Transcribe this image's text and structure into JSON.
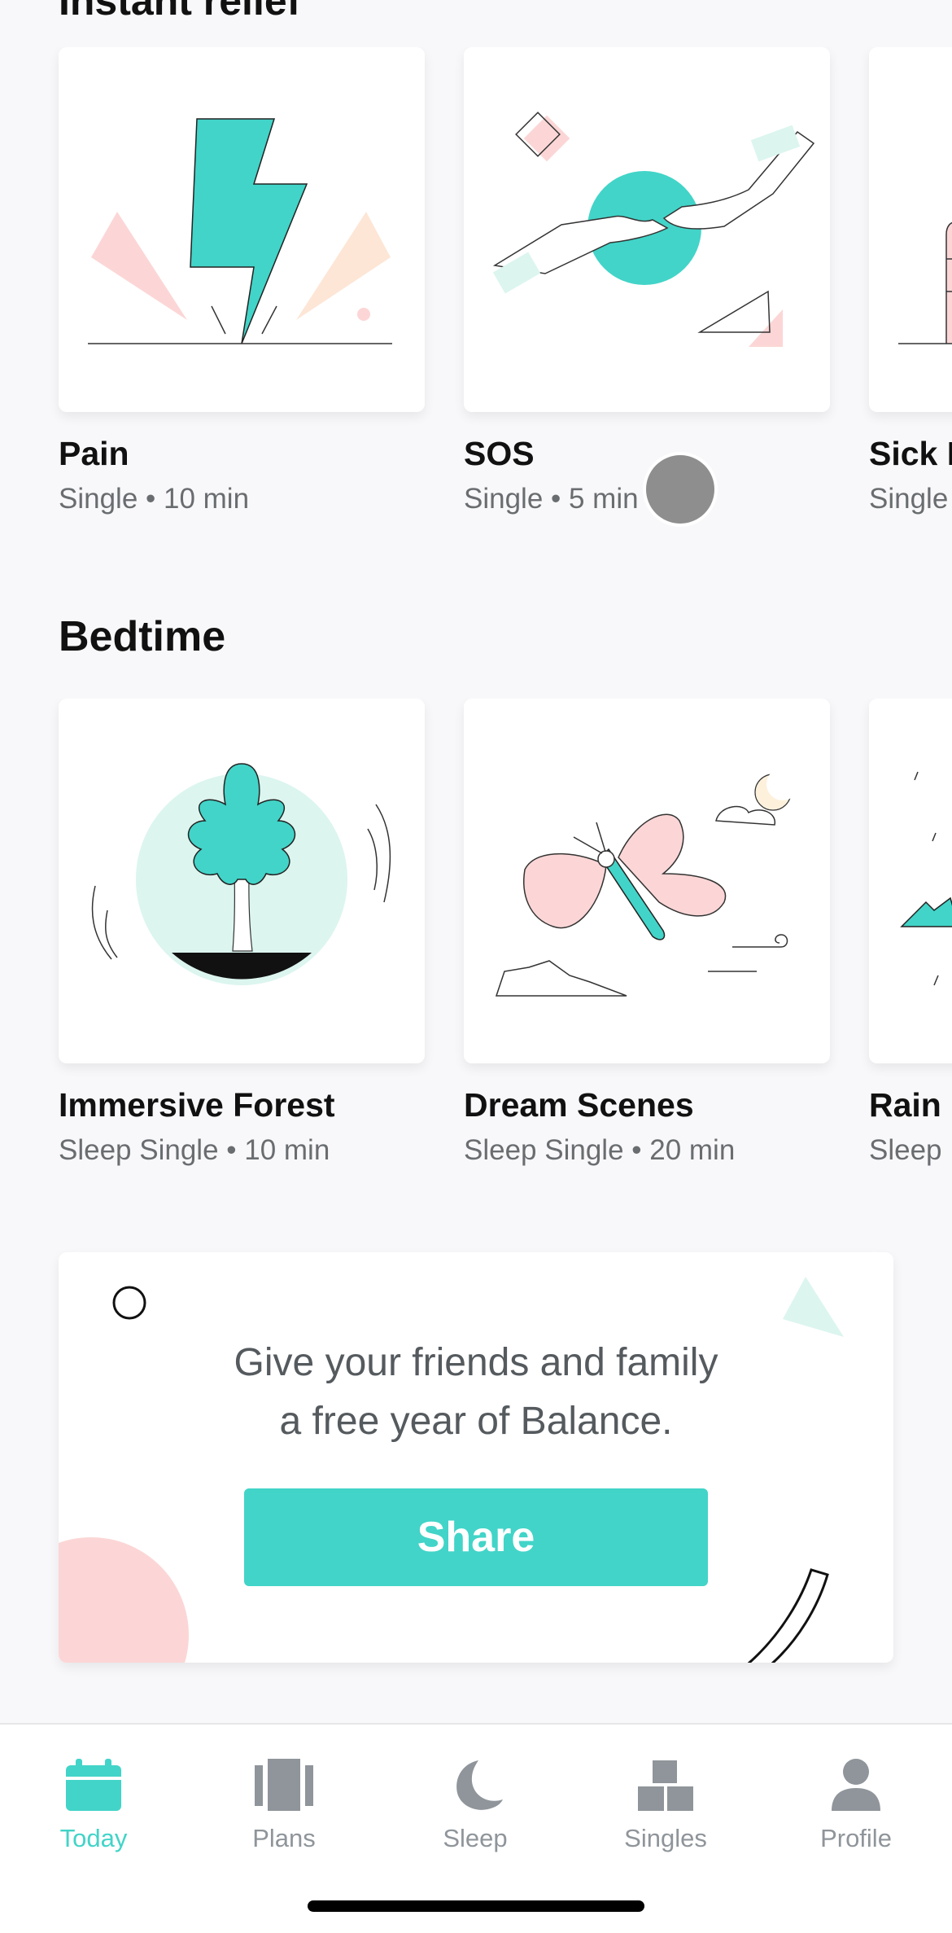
{
  "sections": {
    "instant_relief": {
      "title": "Instant relief",
      "cards": [
        {
          "name": "Pain",
          "meta": "Single • 10 min",
          "art": "lightning-icon"
        },
        {
          "name": "SOS",
          "meta": "Single • 5 min",
          "art": "hands-icon"
        },
        {
          "name": "Sick D",
          "meta": "Single",
          "art": "building-icon"
        }
      ]
    },
    "bedtime": {
      "title": "Bedtime",
      "cards": [
        {
          "name": "Immersive Forest",
          "meta": "Sleep Single • 10 min",
          "art": "tree-icon"
        },
        {
          "name": "Dream Scenes",
          "meta": "Sleep Single • 20 min",
          "art": "butterfly-icon"
        },
        {
          "name": "Rain",
          "meta": "Sleep",
          "art": "rain-icon"
        }
      ]
    }
  },
  "promo": {
    "line1": "Give your friends and family",
    "line2": "a free year of Balance.",
    "button": "Share"
  },
  "tabbar": {
    "items": [
      {
        "label": "Today",
        "icon": "calendar-icon",
        "active": true
      },
      {
        "label": "Plans",
        "icon": "plans-icon",
        "active": false
      },
      {
        "label": "Sleep",
        "icon": "moon-icon",
        "active": false
      },
      {
        "label": "Singles",
        "icon": "blocks-icon",
        "active": false
      },
      {
        "label": "Profile",
        "icon": "person-icon",
        "active": false
      }
    ]
  },
  "colors": {
    "accent": "#42d4c8",
    "pink": "#fcd6d6",
    "mint": "#dcf5ef",
    "inactive": "#8f959a"
  }
}
